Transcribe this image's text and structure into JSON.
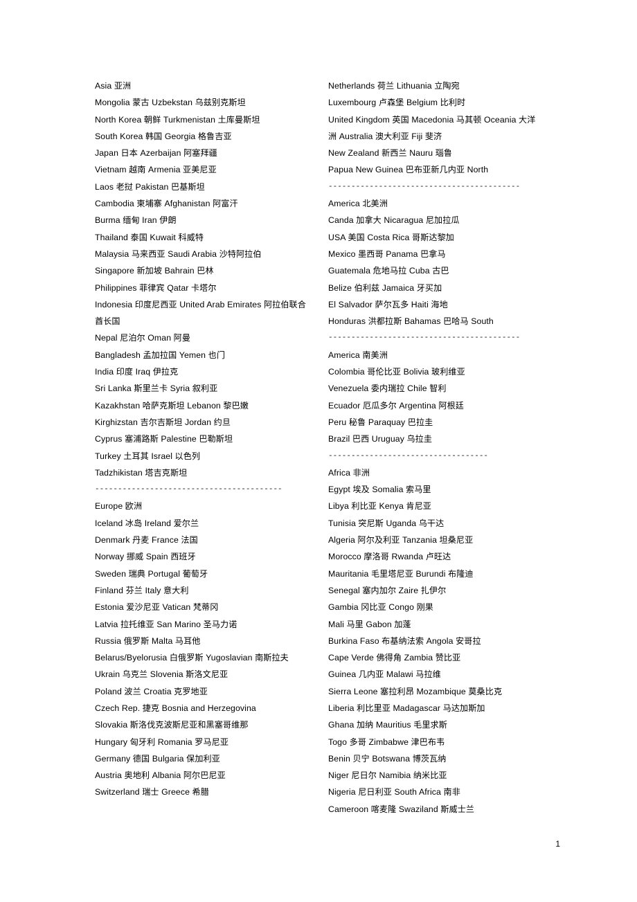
{
  "document": {
    "page_number": "1",
    "separator_short": "-----------------------------------",
    "separator_medium": "-----------------------------------------",
    "separator_long": "------------------------------------------",
    "columns": {
      "left": [
        {
          "type": "entry",
          "text": "Asia  亚洲"
        },
        {
          "type": "entry",
          "text": "Mongolia   蒙古 Uzbekstan   乌兹别克斯坦"
        },
        {
          "type": "entry",
          "text": "North Korea   朝鲜 Turkmenistan   土库曼斯坦"
        },
        {
          "type": "entry",
          "text": "South Korea   韩国  Georgia   格鲁吉亚"
        },
        {
          "type": "entry",
          "text": "Japan 日本  Azerbaijan   阿塞拜疆"
        },
        {
          "type": "entry",
          "text": "Vietnam  越南  Armenia   亚美尼亚"
        },
        {
          "type": "entry",
          "text": "Laos  老挝 Pakistan   巴基斯坦"
        },
        {
          "type": "entry",
          "text": "Cambodia   柬埔寨 Afghanistan   阿富汗"
        },
        {
          "type": "entry",
          "text": "Burma  缅甸 Iran  伊朗"
        },
        {
          "type": "entry",
          "text": "Thailand   泰国  Kuwait  科威特"
        },
        {
          "type": "entry",
          "text": "Malaysia   马来西亚   Saudi Arabia   沙特阿拉伯"
        },
        {
          "type": "entry",
          "text": "Singapore   新加坡 Bahrain   巴林"
        },
        {
          "type": "entry",
          "text": "Philippines   菲律宾 Qatar  卡塔尔"
        },
        {
          "type": "entry-wrap",
          "text": "Indonesia   印度尼西亚   United  Arab  Emirates   阿拉伯联合酋长国"
        },
        {
          "type": "entry",
          "text": "Nepal 尼泊尔  Oman  阿曼"
        },
        {
          "type": "entry",
          "text": "Bangladesh   孟加拉国  Yemen  也门"
        },
        {
          "type": "entry",
          "text": "India  印度  Iraq  伊拉克"
        },
        {
          "type": "entry",
          "text": "Sri Lanka   斯里兰卡  Syria  叙利亚"
        },
        {
          "type": "entry",
          "text": "Kazakhstan   哈萨克斯坦  Lebanon   黎巴嫩"
        },
        {
          "type": "entry",
          "text": "Kirghizstan   吉尔吉斯坦   Jordan   约旦"
        },
        {
          "type": "entry",
          "text": "Cyprus   塞浦路斯  Palestine   巴勒斯坦"
        },
        {
          "type": "entry",
          "text": "Turkey  土耳其  Israel  以色列"
        },
        {
          "type": "entry",
          "text": "Tadzhikistan   塔吉克斯坦"
        },
        {
          "type": "separator",
          "length": "medium"
        },
        {
          "type": "entry",
          "text": "Europe   欧洲"
        },
        {
          "type": "entry",
          "text": "Iceland   冰岛 Ireland   爱尔兰"
        },
        {
          "type": "entry",
          "text": "Denmark   丹麦 France   法国"
        },
        {
          "type": "entry",
          "text": "Norway  挪威 Spain  西班牙"
        },
        {
          "type": "entry",
          "text": "Sweden  瑞典 Portugal   葡萄牙"
        },
        {
          "type": "entry",
          "text": "Finland  芬兰 Italy  意大利"
        },
        {
          "type": "entry",
          "text": "Estonia  爱沙尼亚  Vatican  梵蒂冈"
        },
        {
          "type": "entry",
          "text": "Latvia  拉托维亚  San Marino   圣马力诺"
        },
        {
          "type": "entry",
          "text": "Russia  俄罗斯  Malta  马耳他"
        },
        {
          "type": "entry-wrap",
          "text": "Belarus/Byelorusia    白俄罗斯   Yugoslavian   南斯拉夫"
        },
        {
          "type": "entry",
          "text": "Ukrain  乌克兰  Slovenia   斯洛文尼亚"
        },
        {
          "type": "entry",
          "text": "Poland  波兰 Croatia   克罗地亚"
        },
        {
          "type": "entry",
          "text": "Czech Rep. 捷克  Bosnia and Herzegovina"
        },
        {
          "type": "entry",
          "text": "Slovakia  斯洛伐克波斯尼亚和黑塞哥维那"
        },
        {
          "type": "entry",
          "text": "Hungary   匈牙利 Romania   罗马尼亚"
        },
        {
          "type": "entry",
          "text": "Germany   德国 Bulgaria   保加利亚"
        },
        {
          "type": "entry",
          "text": "Austria  奥地利  Albania  阿尔巴尼亚"
        },
        {
          "type": "entry",
          "text": "Switzerland   瑞士 Greece   希腊"
        }
      ],
      "right": [
        {
          "type": "entry",
          "text": "Netherlands   荷兰 Lithuania   立陶宛"
        },
        {
          "type": "entry",
          "text": "Luxembourg   卢森堡 Belgium   比利时"
        },
        {
          "type": "entry-wrap",
          "text": "United Kingdom   英国 Macedonia   马其顿   Oceania  大洋洲   Australia   澳大利亚  Fiji 斐济"
        },
        {
          "type": "entry",
          "text": "New Zealand   新西兰  Nauru  瑙鲁"
        },
        {
          "type": "entry",
          "text": "Papua New Guinea    巴布亚新几内亚   North"
        },
        {
          "type": "separator",
          "length": "long"
        },
        {
          "type": "entry",
          "text": "America   北美洲"
        },
        {
          "type": "entry",
          "text": "Canda  加拿大  Nicaragua   尼加拉瓜"
        },
        {
          "type": "entry",
          "text": "USA  美国  Costa Rica   哥斯达黎加"
        },
        {
          "type": "entry",
          "text": "Mexico  墨西哥  Panama  巴拿马"
        },
        {
          "type": "entry",
          "text": "Guatemala   危地马拉  Cuba  古巴"
        },
        {
          "type": "entry",
          "text": "Belize  伯利兹  Jamaica   牙买加"
        },
        {
          "type": "entry",
          "text": "El Salvador   萨尔瓦多  Haiti  海地"
        },
        {
          "type": "entry",
          "text": "Honduras   洪都拉斯  Bahamas   巴哈马   South"
        },
        {
          "type": "separator",
          "length": "long"
        },
        {
          "type": "entry",
          "text": "America   南美洲"
        },
        {
          "type": "entry",
          "text": "Colombia   哥伦比亚  Bolivia   玻利维亚"
        },
        {
          "type": "entry",
          "text": "Venezuela   委内瑞拉  Chile  智利"
        },
        {
          "type": "entry",
          "text": "Ecuador  厄瓜多尔  Argentina   阿根廷"
        },
        {
          "type": "entry",
          "text": "Peru  秘鲁 Paraquay   巴拉圭"
        },
        {
          "type": "entry",
          "text": "Brazil  巴西  Uruguay   乌拉圭"
        },
        {
          "type": "separator",
          "length": "short"
        },
        {
          "type": "entry",
          "text": "Africa  非洲"
        },
        {
          "type": "entry",
          "text": "Egypt  埃及 Somalia   索马里"
        },
        {
          "type": "entry",
          "text": "Libya  利比亚 Kenya  肯尼亚"
        },
        {
          "type": "entry",
          "text": "Tunisia  突尼斯 Uganda  乌干达"
        },
        {
          "type": "entry",
          "text": "Algeria  阿尔及利亚  Tanzania  坦桑尼亚"
        },
        {
          "type": "entry",
          "text": "Morocco  摩洛哥  Rwanda  卢旺达"
        },
        {
          "type": "entry",
          "text": "Mauritania   毛里塔尼亚  Burundi  布隆迪"
        },
        {
          "type": "entry",
          "text": "Senegal  塞内加尔  Zaire  扎伊尔"
        },
        {
          "type": "entry",
          "text": "Gambia  冈比亚  Congo  刚果"
        },
        {
          "type": "entry",
          "text": "Mali  马里  Gabon  加蓬"
        },
        {
          "type": "entry",
          "text": "Burkina Faso   布基纳法索   Angola  安哥拉"
        },
        {
          "type": "entry",
          "text": "Cape Verde   佛得角 Zambia  赞比亚"
        },
        {
          "type": "entry",
          "text": "Guinea  几内亚  Malawi  马拉维"
        },
        {
          "type": "entry",
          "text": "Sierra Leone   塞拉利昂  Mozambique   莫桑比克"
        },
        {
          "type": "entry",
          "text": "Liberia  利比里亚  Madagascar   马达加斯加"
        },
        {
          "type": "entry",
          "text": "Ghana  加纳 Mauritius  毛里求斯"
        },
        {
          "type": "entry",
          "text": "Togo  多哥 Zimbabwe   津巴布韦"
        },
        {
          "type": "entry",
          "text": "Benin  贝宁 Botswana   博茨瓦纳"
        },
        {
          "type": "entry",
          "text": "Niger  尼日尔 Namibia   纳米比亚"
        },
        {
          "type": "entry",
          "text": "Nigeria  尼日利亚  South Africa   南非"
        },
        {
          "type": "entry",
          "text": "Cameroon   喀麦隆  Swaziland   斯威士兰"
        }
      ]
    }
  }
}
